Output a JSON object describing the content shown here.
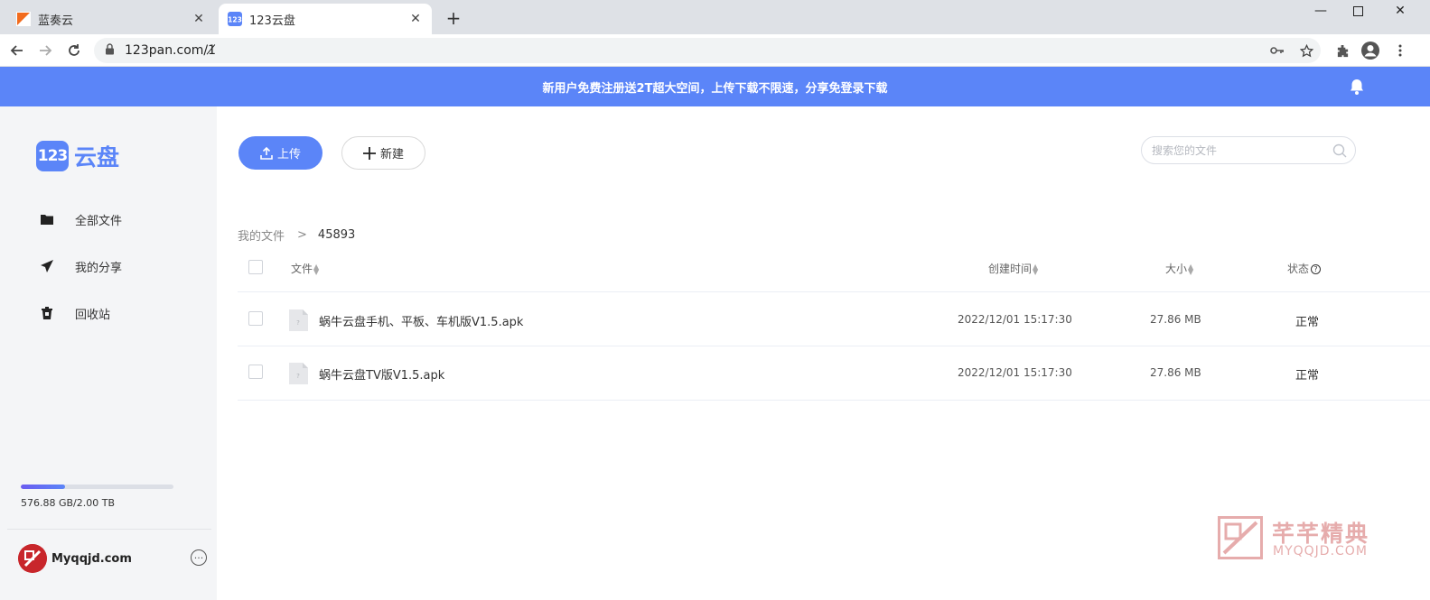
{
  "browser": {
    "tabs": [
      {
        "title": "蓝奏云",
        "active": false
      },
      {
        "title": "123云盘",
        "active": true
      }
    ],
    "url": "123pan.com/1̸"
  },
  "banner": {
    "text": "新用户免费注册送2T超大空间，上传下载不限速，分享免登录下载"
  },
  "sidebar": {
    "logo_badge": "123",
    "logo_text": "云盘",
    "items": [
      {
        "label": "全部文件",
        "icon": "folder-icon"
      },
      {
        "label": "我的分享",
        "icon": "send-icon"
      },
      {
        "label": "回收站",
        "icon": "trash-icon"
      }
    ],
    "storage": {
      "used_fraction": 0.288,
      "text": "576.88 GB/2.00 TB"
    },
    "user": {
      "name": "Myqqjd.com"
    }
  },
  "toolbar": {
    "upload_label": "上传",
    "new_label": "新建"
  },
  "search": {
    "placeholder": "搜索您的文件"
  },
  "breadcrumb": {
    "root": "我的文件",
    "separator": ">",
    "current": "45893"
  },
  "table": {
    "headers": {
      "name": "文件",
      "created": "创建时间",
      "size": "大小",
      "status": "状态"
    },
    "rows": [
      {
        "name": "蜗牛云盘手机、平板、车机版V1.5.apk",
        "created": "2022/12/01 15:17:30",
        "size": "27.86 MB",
        "status": "正常"
      },
      {
        "name": "蜗牛云盘TV版V1.5.apk",
        "created": "2022/12/01 15:17:30",
        "size": "27.86 MB",
        "status": "正常"
      }
    ]
  },
  "watermark": {
    "cn": "芊芊精典",
    "en": "MYQQJD.COM"
  },
  "colors": {
    "accent": "#5b85f8",
    "sidebar_bg": "#f4f5f7",
    "watermark": "#c84a4a"
  }
}
